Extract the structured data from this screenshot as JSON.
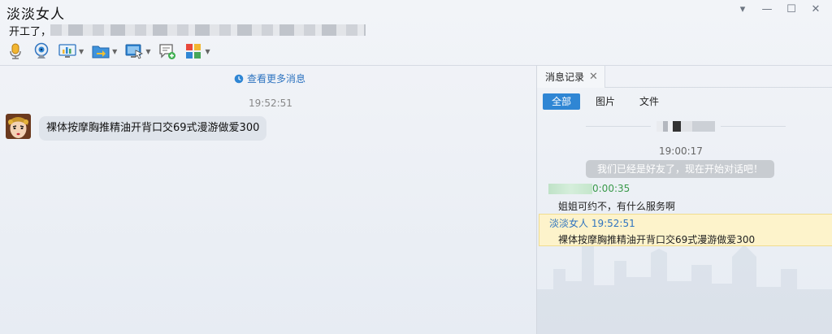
{
  "window": {
    "contact_name": "淡淡女人",
    "status_prefix": "开工了，",
    "controls": [
      "▾",
      "—",
      "☐",
      "✕"
    ]
  },
  "toolbar": {
    "items": [
      {
        "name": "voice-call-button",
        "icon": "microphone-icon",
        "has_menu": false
      },
      {
        "name": "video-call-button",
        "icon": "webcam-icon",
        "has_menu": false
      },
      {
        "name": "screen-share-button",
        "icon": "chart-monitor-icon",
        "has_menu": true
      },
      {
        "name": "send-file-button",
        "icon": "folder-arrow-icon",
        "has_menu": true
      },
      {
        "name": "remote-assist-button",
        "icon": "remote-desktop-icon",
        "has_menu": true
      },
      {
        "name": "new-chat-button",
        "icon": "chat-add-icon",
        "has_menu": false
      },
      {
        "name": "apps-button",
        "icon": "apps-grid-icon",
        "has_menu": true
      }
    ]
  },
  "chat": {
    "more_messages": "查看更多消息",
    "message_time": "19:52:51",
    "message_text": "裸体按摩胸推精油开背口交69式漫游做爱300"
  },
  "history": {
    "tab_label": "消息记录",
    "filters": [
      "全部",
      "图片",
      "文件"
    ],
    "active_filter": "全部",
    "first_time": "19:00:17",
    "system_message": "我们已经是好友了，现在开始对话吧！",
    "entry1_time": "0:00:35",
    "entry1_text": "姐姐可约不，有什么服务啊",
    "entry2_header": "淡淡女人 19:52:51",
    "entry2_text": "裸体按摩胸推精油开背口交69式漫游做爱300"
  },
  "colors": {
    "accent_blue": "#2f86d4",
    "link_blue": "#2f74c0",
    "highlight_yellow": "#fdf3cb",
    "green_time": "#3a9a4a"
  }
}
